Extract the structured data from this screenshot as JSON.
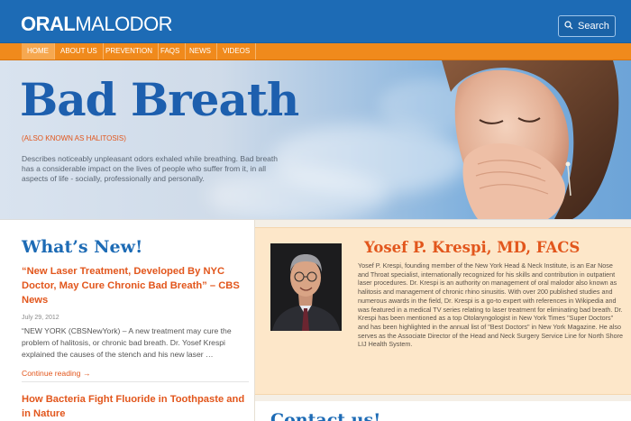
{
  "header": {
    "logo_bold": "ORAL",
    "logo_light": "MALODOR",
    "search_label": "Search",
    "search_icon": "search-icon",
    "brand_color": "#1d6bb5"
  },
  "nav": {
    "items": [
      {
        "label": "HOME"
      },
      {
        "label": "ABOUT US"
      },
      {
        "label": "PREVENTION"
      },
      {
        "label": "FAQS"
      },
      {
        "label": "NEWS"
      },
      {
        "label": "VIDEOS"
      }
    ],
    "active": "HOME",
    "accent_color": "#f08a1c"
  },
  "hero": {
    "title": "Bad Breath",
    "aka": "(ALSO KNOWN AS  HALITOSIS)",
    "description": "Describes noticeably unpleasant odors exhaled while breathing. Bad breath has a considerable impact on the lives of people who suffer from it, in all aspects of life - socially, professionally and personally."
  },
  "news": {
    "heading": "What’s New!",
    "posts": [
      {
        "title": "“New Laser Treatment, Developed By NYC Doctor, May Cure Chronic Bad Breath” – CBS News",
        "date": "July 29, 2012",
        "excerpt": "“NEW YORK (CBSNewYork) – A new treatment may cure the problem of halitosis, or chronic bad breath. Dr. Yosef Krespi explained the causes of the stench and his new laser …",
        "continue_label": "Continue reading →"
      },
      {
        "title": "How Bacteria Fight Fluoride in Toothpaste and in Nature"
      }
    ]
  },
  "doctor": {
    "name": "Yosef P. Krespi, MD, FACS",
    "bio": "Yosef P. Krespi, founding member of the New York Head & Neck Institute, is an Ear Nose and Throat specialist, internationally recognized for his skills and contribution in outpatient laser procedures. Dr. Krespi is an authority on management of oral malodor also known as halitosis and management of chronic rhino sinusitis. With over 200 published studies and numerous awards in the field, Dr. Krespi is a go-to expert with references in Wikipedia and was featured in a medical TV series relating to laser treatment for eliminating bad breath. Dr. Krespi has been mentioned as a top Otolaryngologist in New York Times \"Super Doctors\" and has been highlighted in the annual list of \"Best Doctors\" in New York Magazine. He also serves as the Associate Director of the Head and Neck Surgery Service Line for North Shore LIJ Health System."
  },
  "contact": {
    "heading": "Contact us!"
  }
}
